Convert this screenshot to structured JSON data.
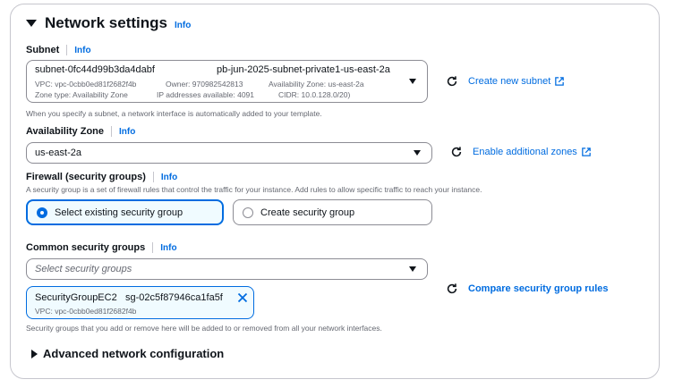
{
  "section": {
    "title": "Network settings",
    "info": "Info"
  },
  "subnet": {
    "label": "Subnet",
    "info": "Info",
    "selected_id": "subnet-0fc44d99b3da4dabf",
    "selected_name": "pb-jun-2025-subnet-private1-us-east-2a",
    "vpc": "VPC: vpc-0cbb0ed81f2682f4b",
    "owner": "Owner: 970982542813",
    "availability_zone": "Availability Zone: us-east-2a",
    "zone_type": "Zone type: Availability Zone",
    "ip_available": "IP addresses available: 4091",
    "cidr": "CIDR: 10.0.128.0/20)",
    "hint": "When you specify a subnet, a network interface is automatically added to your template.",
    "create_link": "Create new subnet"
  },
  "availability_zone": {
    "label": "Availability Zone",
    "info": "Info",
    "value": "us-east-2a",
    "enable_link": "Enable additional zones"
  },
  "firewall": {
    "label": "Firewall (security groups)",
    "info": "Info",
    "description": "A security group is a set of firewall rules that control the traffic for your instance. Add rules to allow specific traffic to reach your instance.",
    "options": [
      {
        "label": "Select existing security group",
        "selected": true
      },
      {
        "label": "Create security group",
        "selected": false
      }
    ]
  },
  "common_sg": {
    "label": "Common security groups",
    "info": "Info",
    "placeholder": "Select security groups",
    "token_name": "SecurityGroupEC2",
    "token_id": "sg-02c5f87946ca1fa5f",
    "token_vpc": "VPC: vpc-0cbb0ed81f2682f4b",
    "compare_link": "Compare security group rules",
    "hint": "Security groups that you add or remove here will be added to or removed from all your network interfaces."
  },
  "advanced": {
    "title": "Advanced network configuration"
  },
  "colors": {
    "link": "#006ce0",
    "border": "#8c8c94",
    "selected_bg": "#f0fbff"
  }
}
